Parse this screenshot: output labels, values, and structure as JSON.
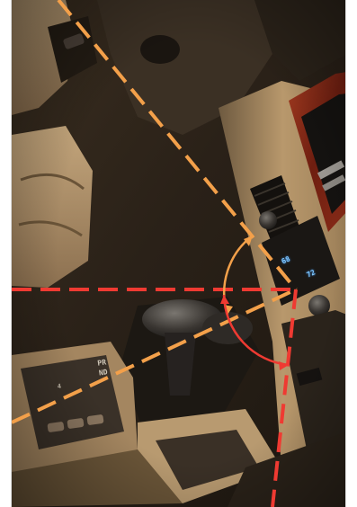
{
  "photo": {
    "subject": "car-interior-dashboard",
    "colors": {
      "dash_tan": "#b39368",
      "dash_dark": "#2d2418",
      "wood_trim": "#7a2414",
      "orange_line": "#f3a04a",
      "red_line": "#ef3a32"
    }
  },
  "labels": {
    "gear_selector": "PRND",
    "gear_selector_left": "4",
    "display_temp_left": "68",
    "display_temp_right": "72"
  }
}
